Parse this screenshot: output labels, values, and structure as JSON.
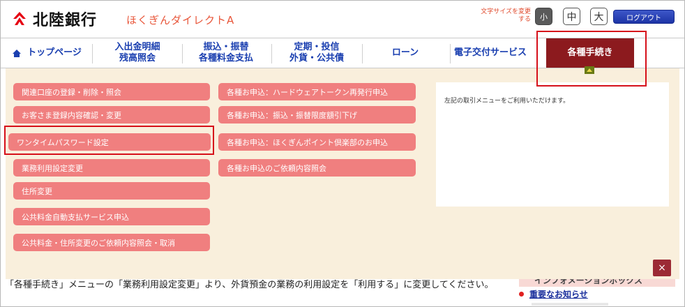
{
  "header": {
    "bank_name": "北陸銀行",
    "service_name": "ほくぎんダイレクトA",
    "font_size_label": "文字サイズを変更する",
    "font_sizes": [
      "小",
      "中",
      "大"
    ],
    "logout_label": "ログアウト"
  },
  "nav": {
    "items": [
      {
        "label": "トップページ"
      },
      {
        "label_line1": "入出金明細",
        "label_line2": "残高照会"
      },
      {
        "label_line1": "振込・振替",
        "label_line2": "各種料金支払"
      },
      {
        "label_line1": "定期・投信",
        "label_line2": "外貨・公共債"
      },
      {
        "label": "ローン"
      },
      {
        "label": "電子交付サービス"
      },
      {
        "label": "各種手続き"
      }
    ]
  },
  "menu": {
    "left": [
      "関連口座の登録・削除・照会",
      "お客さま登録内容確認・変更",
      "ワンタイムパスワード設定",
      "業務利用設定変更",
      "住所変更",
      "公共料金自動支払サービス申込",
      "公共料金・住所変更のご依頼内容照会・取消"
    ],
    "middle": [
      "各種お申込：ハードウェアトークン再発行申込",
      "各種お申込：振込・振替限度額引下げ",
      "各種お申込：ほくぎんポイント倶楽部のお申込",
      "各種お申込のご依頼内容照会"
    ],
    "info_text": "左記の取引メニューをご利用いただけます。",
    "close_label": "×"
  },
  "content": {
    "instruction": "「各種手続き」メニューの「業務利用設定変更」より、外貨預金の業務の利用設定を「利用する」に変更してください。",
    "side_header": "インフォメーションボックス",
    "news_link": "重要なお知らせ"
  },
  "colors": {
    "menu_button": "#f07f7f",
    "active_tab": "#8c1a1e",
    "panel_bg": "#f9efdc",
    "highlight": "#d6101a",
    "nav_text": "#1a3fb0"
  }
}
